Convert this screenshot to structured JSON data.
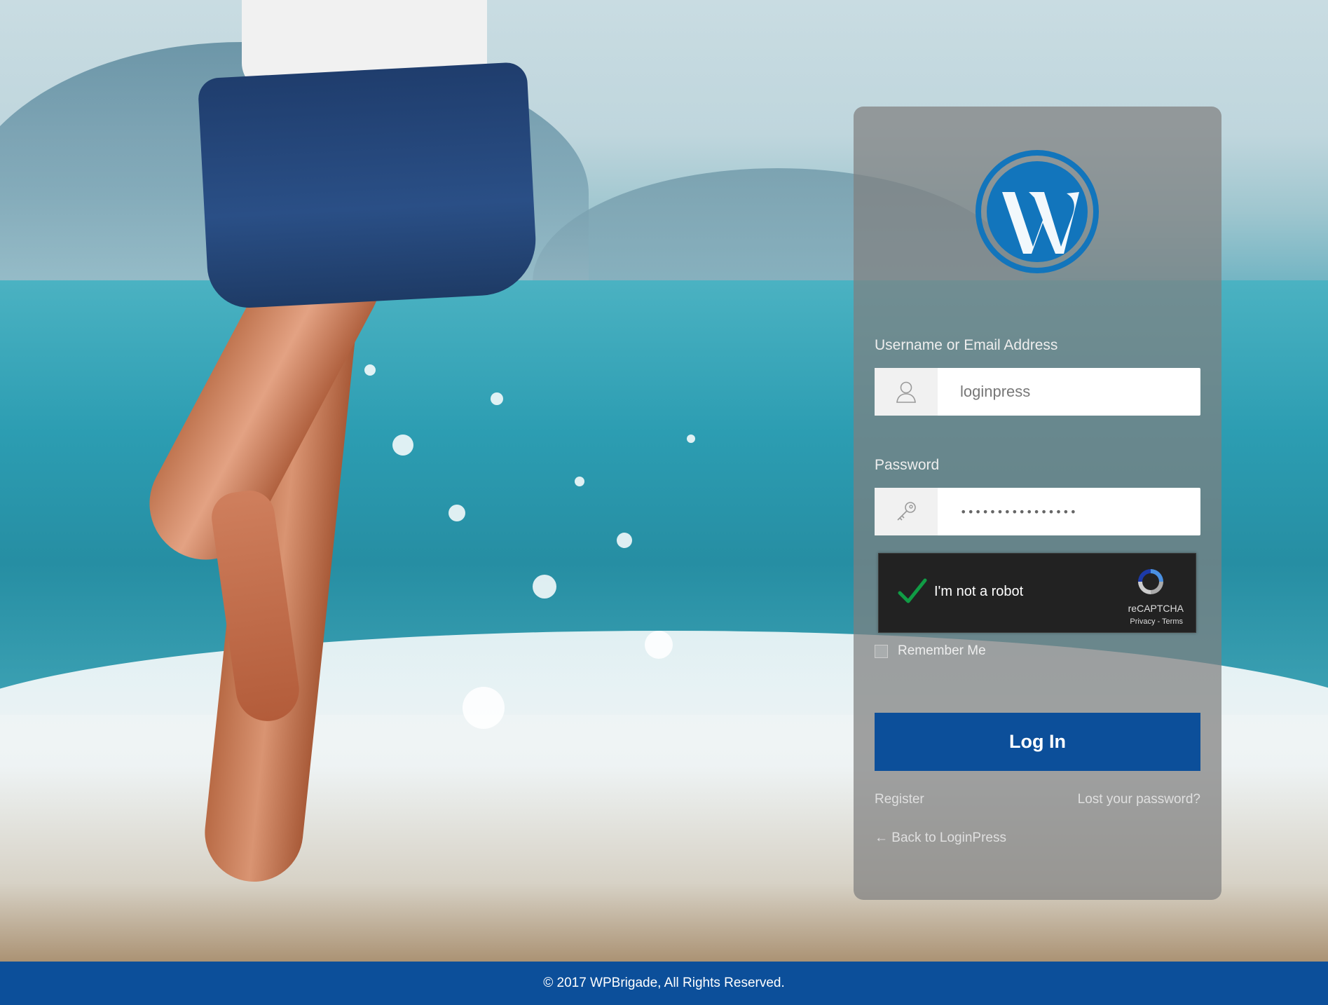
{
  "login": {
    "username_label": "Username or Email Address",
    "username_value": "loginpress",
    "password_label": "Password",
    "password_value": "••••••••••••••••",
    "remember_label": "Remember Me",
    "login_button": "Log In",
    "register_link": "Register",
    "lost_password_link": "Lost your password?",
    "back_link": "← Back to LoginPress"
  },
  "recaptcha": {
    "label": "I'm not a robot",
    "brand": "reCAPTCHA",
    "links": "Privacy - Terms"
  },
  "footer": {
    "copyright": "© 2017 WPBrigade, All Rights Reserved."
  },
  "colors": {
    "accent": "#0c4f9a",
    "wordpress_blue": "#1275bc",
    "check_green": "#109c45"
  }
}
